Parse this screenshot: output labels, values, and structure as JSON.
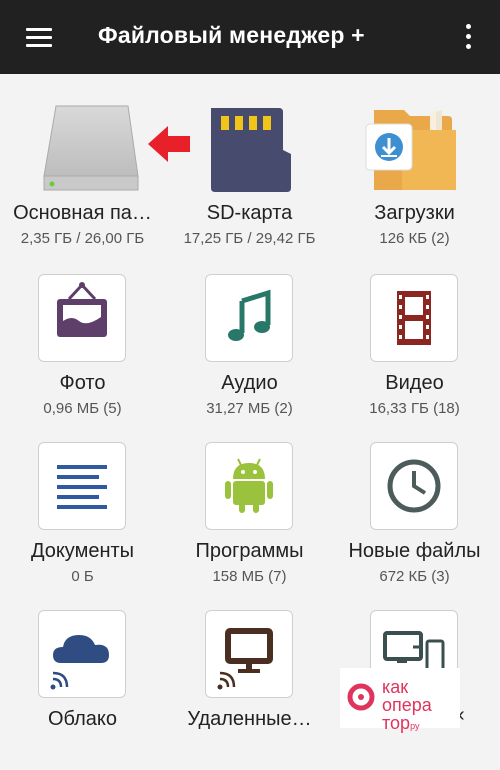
{
  "appbar": {
    "title": "Файловый менеджер +"
  },
  "items": [
    {
      "label": "Основная па…",
      "sub": "2,35 ГБ / 26,00 ГБ"
    },
    {
      "label": "SD-карта",
      "sub": "17,25 ГБ / 29,42 ГБ"
    },
    {
      "label": "Загрузки",
      "sub": "126 КБ (2)"
    },
    {
      "label": "Фото",
      "sub": "0,96 МБ (5)"
    },
    {
      "label": "Аудио",
      "sub": "31,27 МБ (2)"
    },
    {
      "label": "Видео",
      "sub": "16,33 ГБ (18)"
    },
    {
      "label": "Документы",
      "sub": "0 Б"
    },
    {
      "label": "Программы",
      "sub": "158 МБ (7)"
    },
    {
      "label": "Новые файлы",
      "sub": "672 КБ (3)"
    },
    {
      "label": "Облако",
      "sub": ""
    },
    {
      "label": "Удаленные…",
      "sub": ""
    },
    {
      "label": "",
      "sub": ""
    }
  ],
  "watermark": {
    "line1": "как",
    "line2": "опера",
    "line3": "тор",
    "suffix": "ру"
  },
  "edge_glyph": "‹",
  "colors": {
    "appbar": "#212121",
    "background": "#f3f3f3",
    "accent_red": "#e8202a",
    "icon_purple": "#5d3f6a",
    "icon_teal": "#28786a",
    "icon_blue": "#2f5aa0",
    "icon_green": "#9ac23c"
  }
}
